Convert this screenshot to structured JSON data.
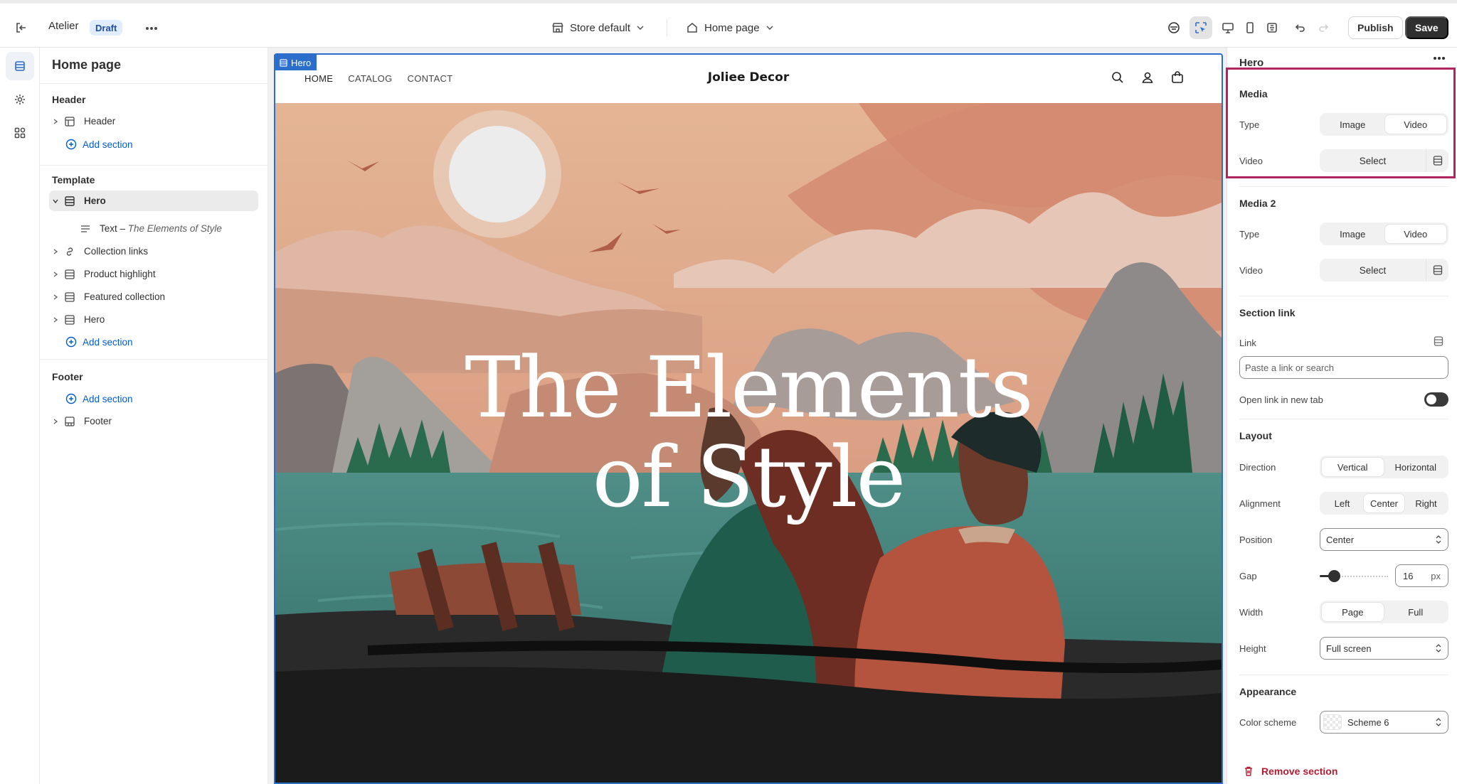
{
  "topbar": {
    "app_name": "Atelier",
    "status_badge": "Draft",
    "store_selector": "Store default",
    "page_selector": "Home page",
    "publish_label": "Publish",
    "save_label": "Save"
  },
  "sidebar": {
    "title": "Home page",
    "header_group": "Header",
    "header_items": [
      {
        "label": "Header"
      }
    ],
    "add_section": "Add section",
    "template_group": "Template",
    "template_items": [
      {
        "label": "Hero",
        "selected": true,
        "expanded": true
      },
      {
        "label": "Text",
        "detail": "The Elements of Style",
        "child": true
      },
      {
        "label": "Collection links"
      },
      {
        "label": "Product highlight"
      },
      {
        "label": "Featured collection"
      },
      {
        "label": "Hero"
      }
    ],
    "footer_group": "Footer",
    "footer_items": [
      {
        "label": "Footer"
      }
    ]
  },
  "preview": {
    "section_tag": "Hero",
    "nav": [
      "HOME",
      "CATALOG",
      "CONTACT"
    ],
    "brand": "Joliee Decor",
    "hero_title_line1": "The Elements",
    "hero_title_line2": "of Style"
  },
  "panel": {
    "title": "Hero",
    "media": {
      "heading": "Media",
      "type_label": "Type",
      "type_options": [
        "Image",
        "Video"
      ],
      "type_selected": "Video",
      "video_label": "Video",
      "video_button": "Select"
    },
    "media2": {
      "heading": "Media 2",
      "type_label": "Type",
      "type_options": [
        "Image",
        "Video"
      ],
      "type_selected": "Video",
      "video_label": "Video",
      "video_button": "Select"
    },
    "section_link": {
      "heading": "Section link",
      "link_label": "Link",
      "link_placeholder": "Paste a link or search",
      "new_tab_label": "Open link in new tab",
      "new_tab_on": false
    },
    "layout": {
      "heading": "Layout",
      "direction_label": "Direction",
      "direction_options": [
        "Vertical",
        "Horizontal"
      ],
      "direction_selected": "Vertical",
      "alignment_label": "Alignment",
      "alignment_options": [
        "Left",
        "Center",
        "Right"
      ],
      "alignment_selected": "Center",
      "position_label": "Position",
      "position_value": "Center",
      "gap_label": "Gap",
      "gap_value": "16",
      "gap_unit": "px",
      "width_label": "Width",
      "width_options": [
        "Page",
        "Full"
      ],
      "width_selected": "Page",
      "height_label": "Height",
      "height_value": "Full screen"
    },
    "appearance": {
      "heading": "Appearance",
      "color_scheme_label": "Color scheme",
      "color_scheme_value": "Scheme 6"
    },
    "remove_label": "Remove section"
  },
  "colors": {
    "accent_blue": "#2c6ecb",
    "highlight": "#b0245f",
    "danger": "#b01e34"
  }
}
